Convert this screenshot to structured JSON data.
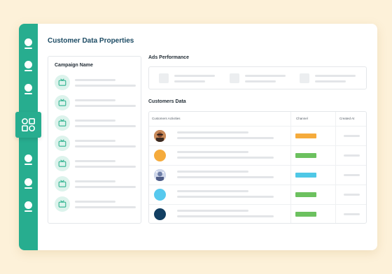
{
  "page": {
    "title": "Customer Data Properties"
  },
  "campaigns": {
    "title": "Campaign Name",
    "row_count": 7
  },
  "ads": {
    "title": "Ads Performance"
  },
  "customers": {
    "title": "Customers Data",
    "columns": [
      "Customers Activities",
      "Channel",
      "Created At"
    ],
    "rows": [
      {
        "avatar": "photo-avatar-man",
        "avatar_color": "#a85c3e",
        "channel_color": "#f5ab3c"
      },
      {
        "avatar": "plain-avatar",
        "avatar_color": "#f5ab3c",
        "channel_color": "#6cc15f"
      },
      {
        "avatar": "photo-avatar-pattern",
        "avatar_color": "#9fb1d6",
        "channel_color": "#4fc8e6"
      },
      {
        "avatar": "plain-avatar",
        "avatar_color": "#57c9ee",
        "channel_color": "#6cc15f"
      },
      {
        "avatar": "plain-avatar",
        "avatar_color": "#123f62",
        "channel_color": "#6cc15f"
      }
    ]
  },
  "sidebar": {
    "icons": [
      "user-icon",
      "user-icon",
      "user-icon",
      "apps-grid-icon",
      "user-icon",
      "user-icon",
      "user-icon"
    ],
    "accent": "#27ad8f"
  },
  "colors": {
    "background": "#fdf1d9",
    "title": "#1b4a63",
    "tv_badge": "#dcf3ec",
    "tv_icon": "#2fb38f"
  }
}
